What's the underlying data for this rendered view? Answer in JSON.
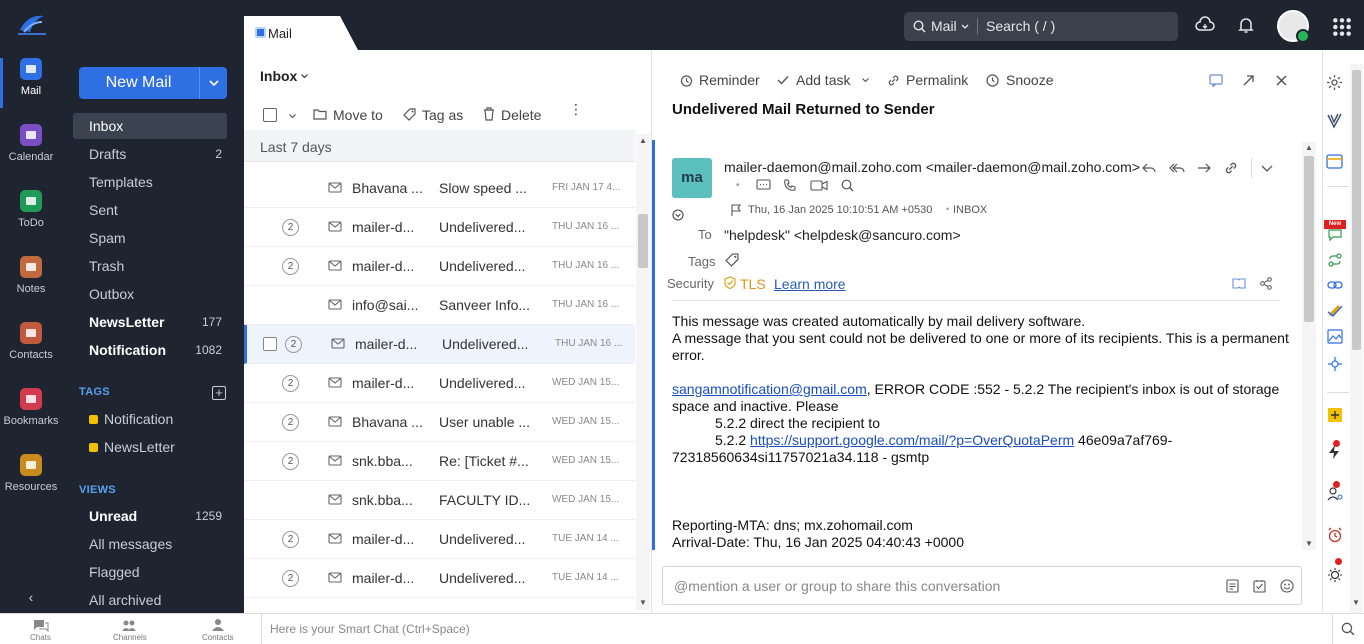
{
  "app": {
    "tab_title": "Mail",
    "search": {
      "scope": "Mail",
      "placeholder": "Search ( / )"
    }
  },
  "rail": [
    {
      "label": "Mail",
      "color": "#2f6fe4",
      "active": true
    },
    {
      "label": "Calendar",
      "color": "#7b4fc4"
    },
    {
      "label": "ToDo",
      "color": "#1f9a57"
    },
    {
      "label": "Notes",
      "color": "#c2693d"
    },
    {
      "label": "Contacts",
      "color": "#c2593d"
    },
    {
      "label": "Bookmarks",
      "color": "#d23a4e"
    },
    {
      "label": "Resources",
      "color": "#c98a1e"
    }
  ],
  "leftnav": {
    "new_mail": "New Mail",
    "folders": [
      {
        "label": "Inbox",
        "count": ""
      },
      {
        "label": "Drafts",
        "count": "2"
      },
      {
        "label": "Templates",
        "count": ""
      },
      {
        "label": "Sent",
        "count": ""
      },
      {
        "label": "Spam",
        "count": ""
      },
      {
        "label": "Trash",
        "count": ""
      },
      {
        "label": "Outbox",
        "count": ""
      },
      {
        "label": "NewsLetter",
        "count": "177"
      },
      {
        "label": "Notification",
        "count": "1082"
      }
    ],
    "tags_header": "TAGS",
    "tags": [
      {
        "label": "Notification"
      },
      {
        "label": "NewsLetter"
      }
    ],
    "views_header": "VIEWS",
    "views": [
      {
        "label": "Unread",
        "count": "1259"
      },
      {
        "label": "All messages",
        "count": ""
      },
      {
        "label": "Flagged",
        "count": ""
      },
      {
        "label": "All archived",
        "count": ""
      }
    ]
  },
  "list": {
    "folder": "Inbox",
    "toolbar": {
      "move_to": "Move to",
      "tag_as": "Tag as",
      "delete": "Delete"
    },
    "group_header": "Last 7 days",
    "rows": [
      {
        "thread": "",
        "from": "Bhavana ...",
        "subject": "Slow speed ...",
        "date": "FRI JAN 17 4..."
      },
      {
        "thread": "2",
        "from": "mailer-d...",
        "subject": "Undelivered...",
        "date": "THU JAN 16 ..."
      },
      {
        "thread": "2",
        "from": "mailer-d...",
        "subject": "Undelivered...",
        "date": "THU JAN 16 ..."
      },
      {
        "thread": "",
        "from": "info@sai...",
        "subject": "Sanveer Info...",
        "date": "THU JAN 16 ..."
      },
      {
        "thread": "2",
        "from": "mailer-d...",
        "subject": "Undelivered...",
        "date": "THU JAN 16 ...",
        "selected": true
      },
      {
        "thread": "2",
        "from": "mailer-d...",
        "subject": "Undelivered...",
        "date": "WED JAN 15..."
      },
      {
        "thread": "2",
        "from": "Bhavana ...",
        "subject": "User unable ...",
        "date": "WED JAN 15..."
      },
      {
        "thread": "2",
        "from": "snk.bba...",
        "subject": "Re: [Ticket #...",
        "date": "WED JAN 15..."
      },
      {
        "thread": "",
        "from": "snk.bba...",
        "subject": "FACULTY ID...",
        "date": "WED JAN 15..."
      },
      {
        "thread": "2",
        "from": "mailer-d...",
        "subject": "Undelivered...",
        "date": "TUE JAN 14 ..."
      },
      {
        "thread": "2",
        "from": "mailer-d...",
        "subject": "Undelivered...",
        "date": "TUE JAN 14 ..."
      }
    ]
  },
  "reader": {
    "toolbar": {
      "reminder": "Reminder",
      "add_task": "Add task",
      "permalink": "Permalink",
      "snooze": "Snooze"
    },
    "subject": "Undelivered Mail Returned to Sender",
    "avatar_initials": "ma",
    "sender": "mailer-daemon@mail.zoho.com <mailer-daemon@mail.zoho.com>",
    "date_line": "Thu, 16 Jan 2025 10:10:51 AM +0530",
    "folder_chip": "INBOX",
    "to_label": "To",
    "to_value": "\"helpdesk\" <helpdesk@sancuro.com>",
    "tags_label": "Tags",
    "security_label": "Security",
    "security_value": "TLS",
    "learn_more": "Learn more",
    "body": {
      "l1": "This message was created automatically by mail delivery software.",
      "l2": "A message that you sent could not be delivered to one or more of its recipients. This is a permanent",
      "l3": "error.",
      "email_link": "sangamnotification@gmail.com",
      "l4_rest": ", ERROR CODE :552 - 5.2.2 The recipient's inbox is out of storage",
      "l5": "space and inactive. Please",
      "l6": "5.2.2 direct the recipient to",
      "l7_prefix": "5.2.2 ",
      "support_link": "https://support.google.com/mail/?p=OverQuotaPerm",
      "l7_rest": " 46e09a7af769-",
      "l8": "72318560634si11757021a34.118 - gsmtp",
      "l9": "Reporting-MTA: dns; mx.zohomail.com",
      "l10": "Arrival-Date: Thu, 16 Jan 2025 04:40:43 +0000"
    },
    "comment_placeholder": "@mention a user or group to share this conversation"
  },
  "bottombar": {
    "chats": "Chats",
    "channels": "Channels",
    "contacts": "Contacts",
    "smart_chat_placeholder": "Here is your Smart Chat (Ctrl+Space)"
  }
}
